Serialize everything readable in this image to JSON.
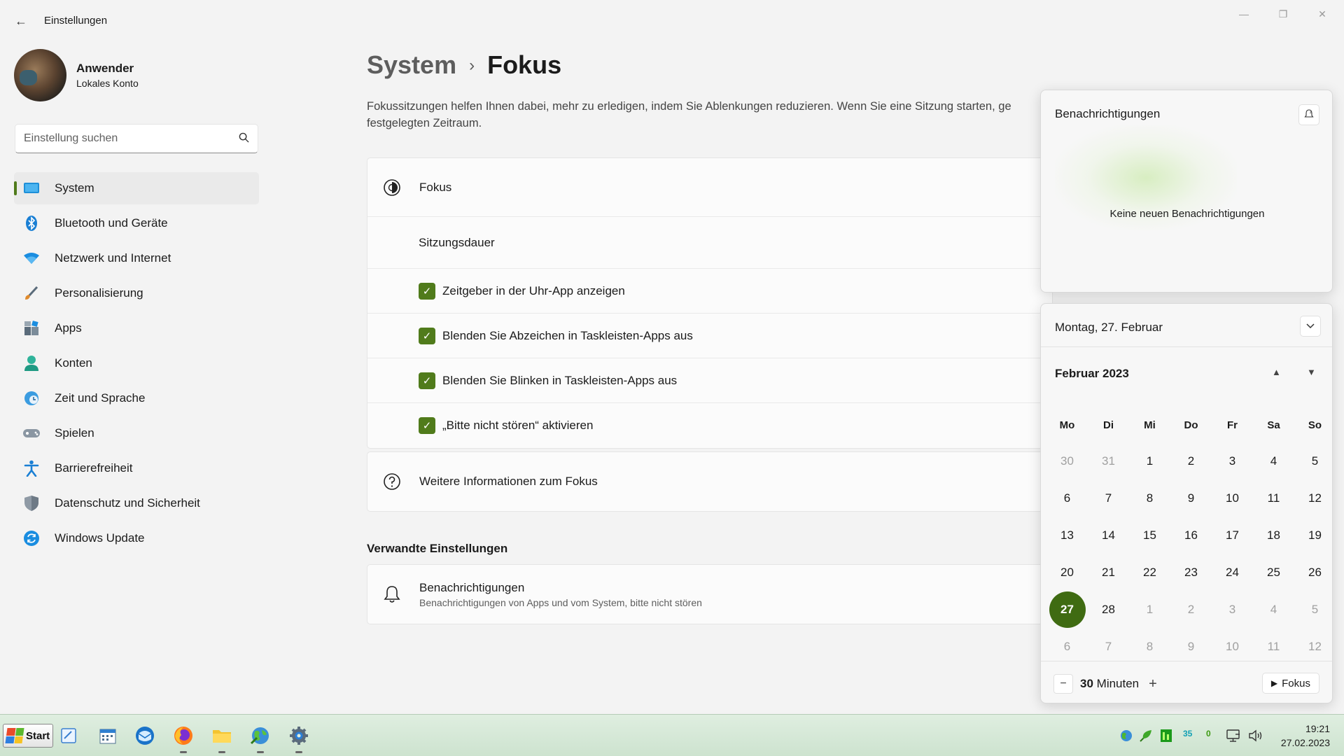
{
  "window": {
    "title": "Einstellungen",
    "minimize_icon": "minimize-icon",
    "maximize_icon": "restore-icon",
    "close_icon": "close-icon"
  },
  "profile": {
    "name": "Anwender",
    "account": "Lokales Konto"
  },
  "search": {
    "placeholder": "Einstellung suchen"
  },
  "sidebar": {
    "items": [
      {
        "label": "System",
        "icon": "monitor-icon",
        "active": true
      },
      {
        "label": "Bluetooth und Geräte",
        "icon": "bluetooth-icon"
      },
      {
        "label": "Netzwerk und Internet",
        "icon": "wifi-icon"
      },
      {
        "label": "Personalisierung",
        "icon": "brush-icon"
      },
      {
        "label": "Apps",
        "icon": "apps-icon"
      },
      {
        "label": "Konten",
        "icon": "person-icon"
      },
      {
        "label": "Zeit und Sprache",
        "icon": "globe-clock-icon"
      },
      {
        "label": "Spielen",
        "icon": "gamepad-icon"
      },
      {
        "label": "Barrierefreiheit",
        "icon": "accessibility-icon"
      },
      {
        "label": "Datenschutz und Sicherheit",
        "icon": "shield-icon"
      },
      {
        "label": "Windows Update",
        "icon": "update-icon"
      }
    ]
  },
  "breadcrumb": {
    "parent": "System",
    "separator": "›",
    "current": "Fokus"
  },
  "description": "Fokussitzungen helfen Ihnen dabei, mehr zu erledigen, indem Sie Ablenkungen reduzieren. Wenn Sie eine Sitzung starten, ge festgelegten Zeitraum.",
  "focus_card": {
    "header": "Fokus",
    "session_label": "Sitzungsdauer",
    "options": [
      {
        "label": "Zeitgeber in der Uhr-App anzeigen",
        "checked": true
      },
      {
        "label": "Blenden Sie Abzeichen in Taskleisten-Apps aus",
        "checked": true
      },
      {
        "label": "Blenden Sie Blinken in Taskleisten-Apps aus",
        "checked": true
      },
      {
        "label": "„Bitte nicht stören“ aktivieren",
        "checked": true
      }
    ]
  },
  "info_card": {
    "label": "Weitere Informationen zum Fokus"
  },
  "related": {
    "title": "Verwandte Einstellungen",
    "items": [
      {
        "label": "Benachrichtigungen",
        "sub": "Benachrichtigungen von Apps und vom System, bitte nicht stören"
      }
    ]
  },
  "notification_center": {
    "title": "Benachrichtigungen",
    "empty_text": "Keine neuen Benachrichtigungen"
  },
  "calendar": {
    "date_header": "Montag, 27. Februar",
    "month_label": "Februar 2023",
    "weekdays": [
      "Mo",
      "Di",
      "Mi",
      "Do",
      "Fr",
      "Sa",
      "So"
    ],
    "days": [
      {
        "d": "30",
        "m": true
      },
      {
        "d": "31",
        "m": true
      },
      {
        "d": "1"
      },
      {
        "d": "2"
      },
      {
        "d": "3"
      },
      {
        "d": "4"
      },
      {
        "d": "5"
      },
      {
        "d": "6"
      },
      {
        "d": "7"
      },
      {
        "d": "8"
      },
      {
        "d": "9"
      },
      {
        "d": "10"
      },
      {
        "d": "11"
      },
      {
        "d": "12"
      },
      {
        "d": "13"
      },
      {
        "d": "14"
      },
      {
        "d": "15"
      },
      {
        "d": "16"
      },
      {
        "d": "17"
      },
      {
        "d": "18"
      },
      {
        "d": "19"
      },
      {
        "d": "20"
      },
      {
        "d": "21"
      },
      {
        "d": "22"
      },
      {
        "d": "23"
      },
      {
        "d": "24"
      },
      {
        "d": "25"
      },
      {
        "d": "26"
      },
      {
        "d": "27",
        "today": true
      },
      {
        "d": "28"
      },
      {
        "d": "1",
        "m": true
      },
      {
        "d": "2",
        "m": true
      },
      {
        "d": "3",
        "m": true
      },
      {
        "d": "4",
        "m": true
      },
      {
        "d": "5",
        "m": true
      },
      {
        "d": "6",
        "m": true
      },
      {
        "d": "7",
        "m": true
      },
      {
        "d": "8",
        "m": true
      },
      {
        "d": "9",
        "m": true
      },
      {
        "d": "10",
        "m": true
      },
      {
        "d": "11",
        "m": true
      },
      {
        "d": "12",
        "m": true
      }
    ],
    "focus_value": "30",
    "focus_unit": "Minuten",
    "focus_button": "Fokus"
  },
  "taskbar": {
    "start_label": "Start",
    "tray_num_a": "35",
    "tray_num_b": "0",
    "time": "19:21",
    "date": "27.02.2023"
  },
  "colors": {
    "accent": "#507b1b",
    "today": "#3f6b12",
    "taskbar": "#d6e9d8"
  }
}
